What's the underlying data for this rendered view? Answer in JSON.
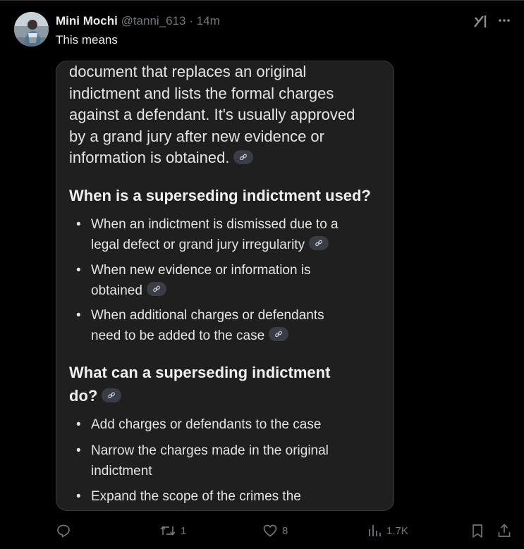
{
  "tweet": {
    "author_name": "Mini Mochi",
    "author_handle": "@tanni_613",
    "separator": "·",
    "time": "14m",
    "text": "This means"
  },
  "card": {
    "paragraph_lines": [
      "document that replaces an original",
      "indictment and lists the formal charges",
      "against a defendant. It's usually approved",
      "by a grand jury after new evidence or",
      "information is obtained."
    ],
    "heading1": "When is a superseding indictment used?",
    "list1": [
      {
        "lines": [
          "When an indictment is dismissed due to a",
          "legal defect or grand jury irregularity"
        ]
      },
      {
        "lines": [
          "When new evidence or information is",
          "obtained"
        ]
      },
      {
        "lines": [
          "When additional charges or defendants",
          "need to be added to the case"
        ]
      }
    ],
    "heading2_lines": [
      "What can a superseding indictment",
      "do?"
    ],
    "list2": [
      {
        "lines": [
          "Add charges or defendants to the case"
        ]
      },
      {
        "lines": [
          "Narrow the charges made in the original",
          "indictment"
        ]
      },
      {
        "lines": [
          "Expand the scope of the crimes the"
        ]
      }
    ],
    "bullet_glyph": "•"
  },
  "actions": {
    "reply_count": "",
    "retweet_count": "1",
    "like_count": "8",
    "views_count": "1.7K"
  },
  "icons": {
    "more": "more-icon",
    "grok": "grok-icon"
  },
  "colors": {
    "background": "#000000",
    "card_bg": "#1f1f1f",
    "muted": "#71767b",
    "chip": "#3a3d45"
  }
}
